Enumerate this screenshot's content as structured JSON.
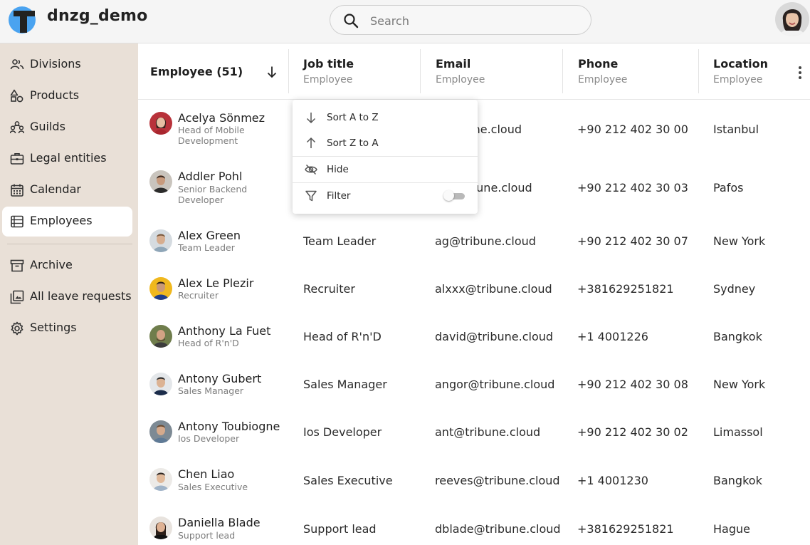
{
  "app": {
    "name": "dnzg_demo"
  },
  "search": {
    "placeholder": "Search"
  },
  "sidebar": {
    "items": [
      {
        "label": "Divisions",
        "icon": "people-icon"
      },
      {
        "label": "Products",
        "icon": "shapes-icon"
      },
      {
        "label": "Guilds",
        "icon": "group-icon"
      },
      {
        "label": "Legal entities",
        "icon": "briefcase-icon"
      },
      {
        "label": "Calendar",
        "icon": "calendar-icon"
      },
      {
        "label": "Employees",
        "icon": "list-icon",
        "active": true
      },
      {
        "label": "Archive",
        "icon": "archive-icon"
      },
      {
        "label": "All leave requests",
        "icon": "gallery-icon"
      },
      {
        "label": "Settings",
        "icon": "gear-icon"
      }
    ]
  },
  "table": {
    "employee_header": "Employee (51)",
    "columns": [
      {
        "title": "Job title",
        "sub": "Employee"
      },
      {
        "title": "Email",
        "sub": "Employee"
      },
      {
        "title": "Phone",
        "sub": "Employee"
      },
      {
        "title": "Location",
        "sub": "Employee"
      }
    ],
    "rows": [
      {
        "name": "Acelya Sönmez",
        "role": "Head of Mobile Development",
        "job": "",
        "email": "@tribune.cloud",
        "phone": "+90 212 402 30 00",
        "location": "Istanbul"
      },
      {
        "name": "Addler Pohl",
        "role": "Senior Backend Developer",
        "job": "",
        "email": "bune.cloud",
        "phone": "+90 212 402 30 03",
        "location": "Pafos"
      },
      {
        "name": "Alex Green",
        "role": "Team Leader",
        "job": "Team Leader",
        "email": "ag@tribune.cloud",
        "phone": "+90 212 402 30 07",
        "location": "New York"
      },
      {
        "name": "Alex Le Plezir",
        "role": "Recruiter",
        "job": "Recruiter",
        "email": "alxxx@tribune.cloud",
        "phone": "+381629251821",
        "location": "Sydney"
      },
      {
        "name": "Anthony La Fuet",
        "role": "Head of R'n'D",
        "job": "Head of R'n'D",
        "email": "david@tribune.cloud",
        "phone": "+1 4001226",
        "location": "Bangkok"
      },
      {
        "name": "Antony Gubert",
        "role": "Sales Manager",
        "job": "Sales Manager",
        "email": "angor@tribune.cloud",
        "phone": "+90 212 402 30 08",
        "location": "New York"
      },
      {
        "name": "Antony Toubiogne",
        "role": "Ios Developer",
        "job": "Ios Developer",
        "email": "ant@tribune.cloud",
        "phone": "+90 212 402 30 02",
        "location": "Limassol"
      },
      {
        "name": "Chen Liao",
        "role": "Sales Executive",
        "job": "Sales Executive",
        "email": "reeves@tribune.cloud",
        "phone": "+1 4001230",
        "location": "Bangkok"
      },
      {
        "name": "Daniella Blade",
        "role": "Support lead",
        "job": "Support lead",
        "email": "dblade@tribune.cloud",
        "phone": "+381629251821",
        "location": "Hague"
      }
    ]
  },
  "menu": {
    "items": [
      {
        "label": "Sort A to Z",
        "icon": "arrow-down-icon"
      },
      {
        "label": "Sort Z to A",
        "icon": "arrow-up-icon"
      },
      {
        "label": "Hide",
        "icon": "eye-off-icon"
      },
      {
        "label": "Filter",
        "icon": "filter-icon"
      }
    ],
    "filter_enabled": false
  },
  "colors": {
    "sidebar_bg": "#e9e0d7",
    "logo_blue": "#4aa3f0",
    "accent_text": "#1f1f1f"
  }
}
